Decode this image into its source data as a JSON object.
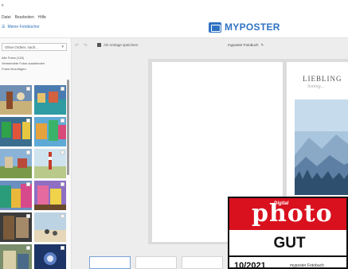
{
  "menu": {
    "close_glyph": "x",
    "items": [
      "Datei",
      "Bearbeiten",
      "Hilfe"
    ]
  },
  "header": {
    "my_projects": "Meine Fotobücher",
    "brand": "MYPOSTER",
    "brand_color": "#2f73c3"
  },
  "sidebar": {
    "select_value": "Ohne Ordner, nach...",
    "links": [
      "Alle Fotos (118)",
      "Verwendete Fotos ausblenden",
      "Fotos hinzufügen"
    ]
  },
  "canvas": {
    "undo_redo": "↶ ↷",
    "save_label": "Als Vorlage speichern",
    "book_title": "myposter Fotobuch",
    "edit_icon": "✎",
    "right_page_title": "LIEBLING",
    "right_page_subtitle": "Sonnig..."
  },
  "badge": {
    "digital": "Digital",
    "magazine": "photo",
    "rating": "GUT",
    "date": "10/2021",
    "fine_print": "myposter Fotobuch",
    "red": "#d9111e"
  }
}
